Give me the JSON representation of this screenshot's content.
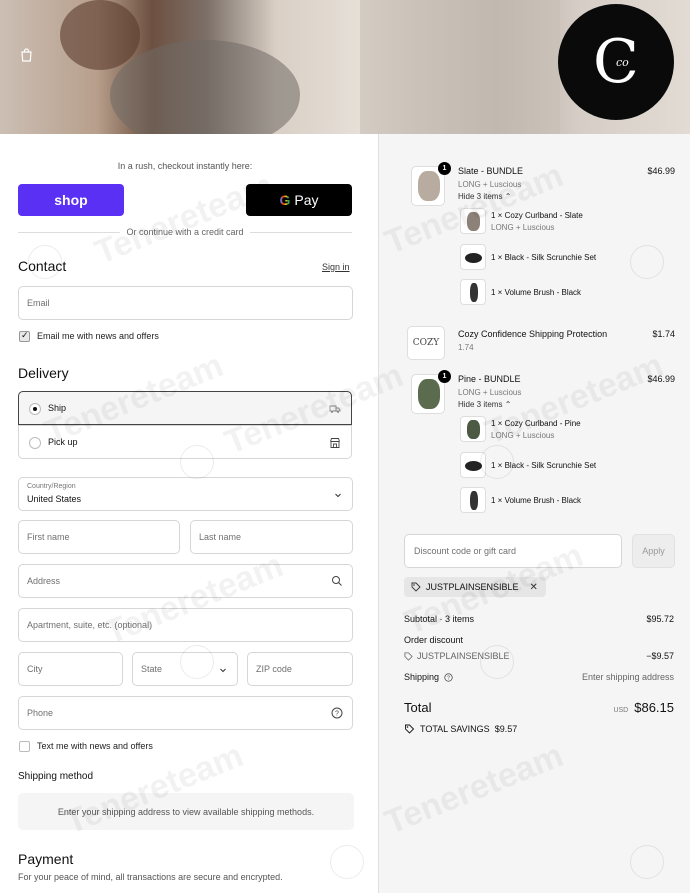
{
  "header": {
    "logo_text": "C",
    "logo_small": "co"
  },
  "checkout": {
    "rush_text": "In a rush, checkout instantly here:",
    "shop_pay_label": "shop",
    "gpay_label": "Pay",
    "or_continue": "Or continue with a credit card"
  },
  "contact": {
    "heading": "Contact",
    "sign_in": "Sign in",
    "email_placeholder": "Email",
    "email_news_label": "Email me with news and offers"
  },
  "delivery": {
    "heading": "Delivery",
    "options": [
      {
        "label": "Ship",
        "selected": true
      },
      {
        "label": "Pick up",
        "selected": false
      }
    ],
    "country_label": "Country/Region",
    "country_value": "United States",
    "first_name": "First name",
    "last_name": "Last name",
    "address": "Address",
    "apartment": "Apartment, suite, etc. (optional)",
    "city": "City",
    "state": "State",
    "zip": "ZIP code",
    "phone": "Phone",
    "text_news_label": "Text me with news and offers"
  },
  "shipping_method": {
    "heading": "Shipping method",
    "message": "Enter your shipping address to view available shipping methods."
  },
  "payment": {
    "heading": "Payment",
    "subtitle": "For your peace of mind, all transactions are secure and encrypted."
  },
  "order": {
    "items": [
      {
        "qty": "1",
        "name": "Slate - BUNDLE",
        "variant": "LONG + Luscious",
        "price": "$46.99",
        "toggle": "Hide 3 items",
        "children": [
          {
            "name": "1 × Cozy Curlband - Slate",
            "variant": "LONG + Luscious"
          },
          {
            "name": "1 × Black - Silk Scrunchie Set",
            "variant": ""
          },
          {
            "name": "1 × Volume Brush - Black",
            "variant": ""
          }
        ]
      },
      {
        "qty": "",
        "name": "Cozy Confidence Shipping Protection",
        "variant": "1.74",
        "price": "$1.74",
        "thumb_text": "COZY"
      },
      {
        "qty": "1",
        "name": "Pine - BUNDLE",
        "variant": "LONG + Luscious",
        "price": "$46.99",
        "toggle": "Hide 3 items",
        "children": [
          {
            "name": "1 × Cozy Curlband - Pine",
            "variant": "LONG + Luscious"
          },
          {
            "name": "1 × Black - Silk Scrunchie Set",
            "variant": ""
          },
          {
            "name": "1 × Volume Brush - Black",
            "variant": ""
          }
        ]
      }
    ],
    "discount_placeholder": "Discount code or gift card",
    "apply_label": "Apply",
    "applied_code": "JUSTPLAINSENSIBLE",
    "subtotal_label": "Subtotal · 3 items",
    "subtotal_value": "$95.72",
    "order_discount_label": "Order discount",
    "discount_code": "JUSTPLAINSENSIBLE",
    "discount_value": "−$9.57",
    "shipping_label": "Shipping",
    "shipping_value": "Enter shipping address",
    "total_label": "Total",
    "currency": "USD",
    "total_value": "$86.15",
    "savings_label": "TOTAL SAVINGS",
    "savings_value": "$9.57"
  },
  "watermark": "Tenereteam"
}
